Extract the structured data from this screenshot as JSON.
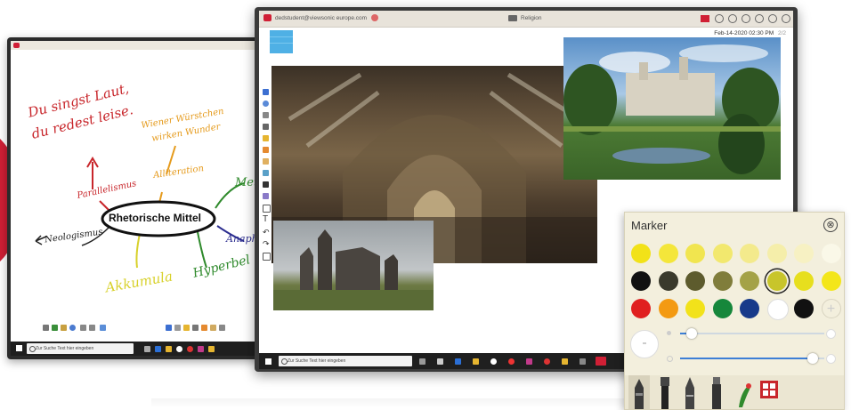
{
  "left_screen": {
    "notes": {
      "red1": "Du singst Laut,",
      "red2": "du redest leise.",
      "orange1": "Wiener Würstchen",
      "orange2": "wirken Wunder",
      "parallel": "Parallelismus",
      "allit": "Alliteration",
      "center": "Rhetorische Mittel",
      "neol": "Neologismus",
      "akk": "Akkumula",
      "hyp": "Hyperbel",
      "met": "Met",
      "ana": "Anaphe"
    },
    "taskbar_search": "Zur Suche Text hier eingeben"
  },
  "main_screen": {
    "user_email": "dedstudent@viewsonic europe.com",
    "title": "Religion",
    "datetime": "Feb-14-2020 02:30 PM",
    "page": "2/2",
    "taskbar_search": "Zur Suche Text hier eingeben"
  },
  "marker_panel": {
    "title": "Marker",
    "close_glyph": "⊗",
    "colors_row1": [
      "#f2e218",
      "#f4e63a",
      "#f1e54f",
      "#f2e86e",
      "#f3ea8c",
      "#f5eeaa",
      "#f7f1c3",
      "#faf8e8"
    ],
    "colors_row2": [
      "#111111",
      "#3a3a2c",
      "#5d5b2d",
      "#807d3b",
      "#a4a247",
      "#c8c52b",
      "#e7df1e",
      "#f3e61a"
    ],
    "colors_row3": [
      "#e02020",
      "#f39a12",
      "#f2e21a",
      "#16873b",
      "#173a8a",
      "#ffffff",
      "#111111"
    ],
    "add_glyph": "+",
    "selected_index_row2": 5,
    "size_level": 0.08,
    "opacity_level": 0.92
  }
}
